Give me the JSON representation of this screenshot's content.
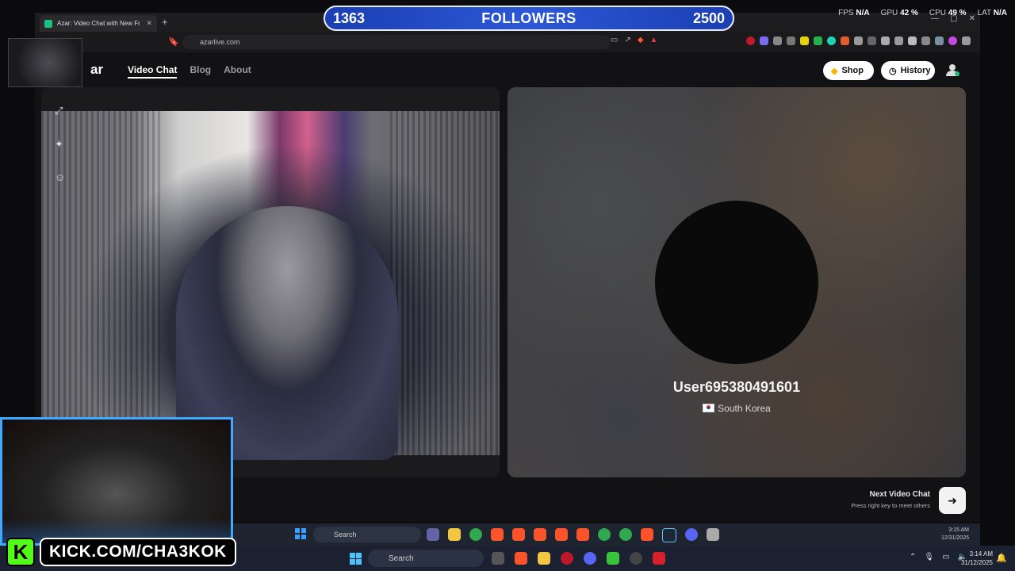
{
  "overlay": {
    "followers_current": "1363",
    "followers_label": "FOLLOWERS",
    "followers_goal": "2500",
    "kick_logo_letter": "K",
    "kick_handle": "KICK.COM/CHA3KOK"
  },
  "perf": {
    "fps_label": "FPS",
    "fps_value": "N/A",
    "gpu_label": "GPU",
    "gpu_value": "42 %",
    "cpu_label": "CPU",
    "cpu_value": "49 %",
    "lat_label": "LAT",
    "lat_value": "N/A"
  },
  "browser": {
    "tab_title": "Azar: Video Chat with New Fr",
    "url": "azarlive.com"
  },
  "site": {
    "logo": "ar",
    "nav": [
      "Video Chat",
      "Blog",
      "About"
    ],
    "shop_label": "Shop",
    "history_label": "History",
    "partner": {
      "username": "User695380491601",
      "country": "South Korea"
    },
    "next_chat_title": "Next Video Chat",
    "next_chat_hint": "Press right key to meet others"
  },
  "inner_taskbar": {
    "search_label": "Search",
    "time": "3:15 AM",
    "date": "12/31/2025"
  },
  "taskbar": {
    "search_label": "Search",
    "time": "3:14 AM",
    "date": "31/12/2025"
  },
  "colors": {
    "followers_bar": "#2c57d6",
    "kick_green": "#53fc18",
    "facecam_border": "#3fa9ff"
  }
}
